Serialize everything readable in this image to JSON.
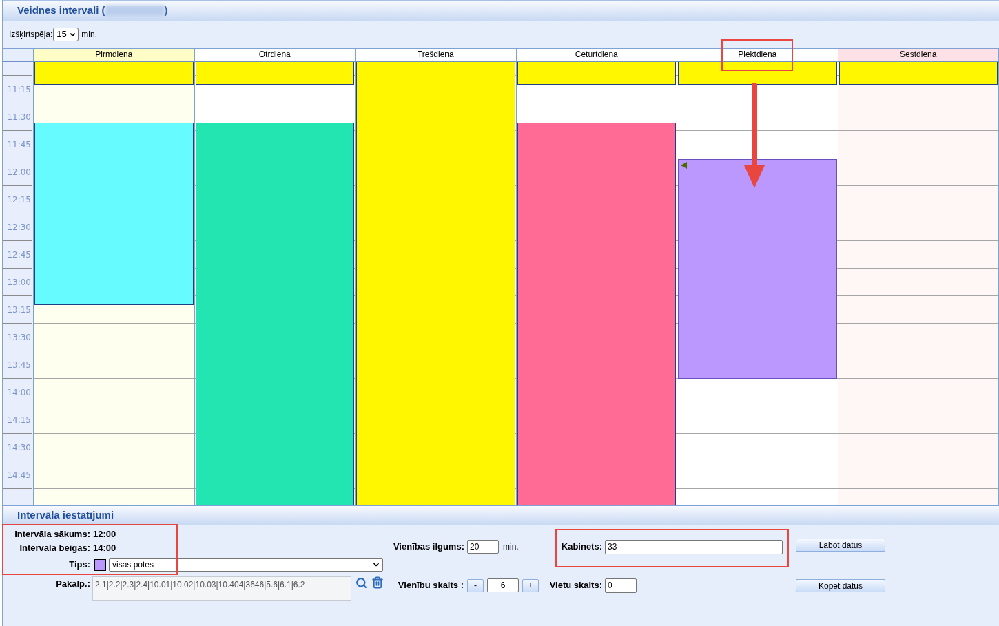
{
  "title": {
    "before": "Veidnes intervali (",
    "after": ")"
  },
  "resolution": {
    "label": "Izšķirtspēja:",
    "value": "15",
    "unit": "min."
  },
  "calendar": {
    "times": [
      "11:15",
      "11:30",
      "11:45",
      "12:00",
      "12:15",
      "12:30",
      "12:45",
      "13:00",
      "13:15",
      "13:30",
      "13:45",
      "14:00",
      "14:15",
      "14:30",
      "14:45"
    ],
    "days": [
      {
        "name": "Pirmdiena",
        "kind": "today",
        "events": [
          {
            "color": "#fff700",
            "selected": false
          },
          {
            "color": "#66fbff",
            "selected": false
          }
        ]
      },
      {
        "name": "Otrdiena",
        "kind": "weekday",
        "events": [
          {
            "color": "#fff700",
            "selected": false
          },
          {
            "color": "#22e5b2",
            "selected": false
          }
        ]
      },
      {
        "name": "Trešdiena",
        "kind": "weekday",
        "events": [
          {
            "color": "#fff700",
            "selected": false
          }
        ]
      },
      {
        "name": "Ceturtdiena",
        "kind": "weekday",
        "events": [
          {
            "color": "#fff700",
            "selected": false
          },
          {
            "color": "#ff6b94",
            "selected": false
          }
        ]
      },
      {
        "name": "Piektdiena",
        "kind": "weekday",
        "events": [
          {
            "color": "#fff700",
            "selected": false
          },
          {
            "color": "#bb98fe",
            "selected": true
          }
        ]
      },
      {
        "name": "Sestdiena",
        "kind": "weekend",
        "events": [
          {
            "color": "#fff700",
            "selected": false
          }
        ]
      }
    ]
  },
  "settings": {
    "title": "Intervāla iestatījumi",
    "start": {
      "label": "Intervāla sākums:",
      "value": "12:00"
    },
    "end": {
      "label": "Intervāla beigas:",
      "value": "14:00"
    },
    "type": {
      "label": "Tips:",
      "color": "#bb98fe",
      "value": "visas potes"
    },
    "services": {
      "label": "Pakalp.:",
      "value": "2.1|2.2|2.3|2.4|10.01|10.02|10.03|10.404|3646|5.6|6.1|6.2"
    },
    "unit_length": {
      "label": "Vienības ilgums:",
      "value": "20",
      "unit": "min."
    },
    "cabinet": {
      "label": "Kabinets:",
      "value": "33"
    },
    "unit_count": {
      "label": "Vienību skaits :",
      "decrement": "-",
      "value": "6",
      "increment": "+"
    },
    "places": {
      "label": "Vietu skaits:",
      "value": "0"
    },
    "buttons": [
      "Labot datus",
      "Kopēt datus"
    ]
  }
}
